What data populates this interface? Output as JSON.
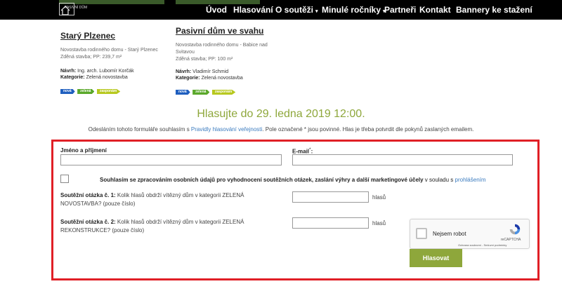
{
  "nav": {
    "logo_text": "PASIVNÍ DŮM",
    "items": [
      {
        "label": "Úvod",
        "caret": false
      },
      {
        "label": "Hlasování",
        "caret": false
      },
      {
        "label": "O soutěži",
        "caret": true
      },
      {
        "label": "Minulé ročníky",
        "caret": true
      },
      {
        "label": "Partneři",
        "caret": false
      },
      {
        "label": "Kontakt",
        "caret": false
      },
      {
        "label": "Bannery ke stažení",
        "caret": false
      }
    ]
  },
  "cards": [
    {
      "title": "Starý Plzenec",
      "desc": [
        "Novostavba rodinného domu - Starý Plzenec",
        "Zděná stavba; PP: 239,7 m²"
      ],
      "author_label": "Návrh:",
      "author": "Ing. arch. Lubomír Korčák",
      "category_label": "Kategorie:",
      "category": "Zelená novostavba",
      "badges": [
        "nová",
        "zelená",
        "zasponám"
      ]
    },
    {
      "title": "Pasivní dům ve svahu",
      "desc": [
        "Novostavba rodinného domu - Babice nad",
        "Svitavou",
        "Zděná stavba; PP: 100 m²"
      ],
      "author_label": "Návrh:",
      "author": "Vladimír Schmid",
      "category_label": "Kategorie:",
      "category": "Zelená novostavba",
      "badges": [
        "nová",
        "zelená",
        "zasponám"
      ]
    }
  ],
  "headline": "Hlasujte do 29. ledna 2019 12:00.",
  "intro": {
    "before": "Odesláním tohoto formuláře souhlasím s ",
    "link": "Pravidly hlasování veřejnosti",
    "after": ". Pole označené * jsou povinné. Hlas je třeba potvrdit dle pokynů zaslaných emailem."
  },
  "form": {
    "name_label": "Jméno a příjmení",
    "name_value": "",
    "email_label": "E-mail",
    "email_required": "*",
    "email_value": "",
    "consent_bold": "Souhlasím se zpracováním osobních údajů pro vyhodnocení soutěžních otázek, zaslání výhry a další marketingové účely",
    "consent_normal": " v souladu s ",
    "consent_link": "prohlášením",
    "q1_label": "Soutěžní otázka č. 1:",
    "q1_text_a": " Kolik hlasů obdrží vítězný dům v kategorii ZELENÁ",
    "q1_text_b": "NOVOSTAVBA? (pouze číslo)",
    "q1_value": "",
    "q1_unit": "hlasů",
    "q2_label": "Soutěžní otázka č. 2:",
    "q2_text_a": " Kolik hlasů obdrží vítězný dům v kategorii ZELENÁ",
    "q2_text_b": "REKONSTRUKCE? (pouze číslo)",
    "q2_value": "",
    "q2_unit": "hlasů",
    "captcha_label": "Nejsem robot",
    "captcha_brand": "reCAPTCHA",
    "captcha_terms": "Ochrana soukromí - Smluvní podmínky",
    "submit_label": "Hlasovat"
  },
  "colors": {
    "accent_green": "#8ea73b",
    "highlight_red": "#e01f26",
    "link_blue": "#3b7bbf",
    "badge_blue": "#1f5fbf",
    "badge_green": "#5aa82a",
    "badge_yellow": "#b7c81f"
  }
}
